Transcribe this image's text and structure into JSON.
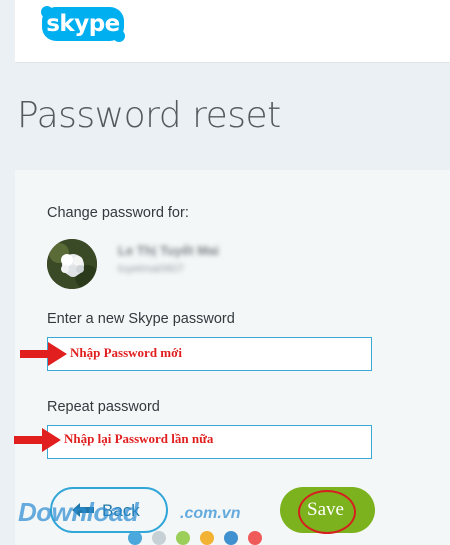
{
  "header": {
    "logo_text": "skype",
    "brand_color": "#00aff0"
  },
  "page": {
    "title": "Password reset"
  },
  "form": {
    "change_for_label": "Change password for:",
    "user": {
      "display_name": "Le Thị Tuyết Mai",
      "username": "tuyetmai0607",
      "blurred": true
    },
    "new_password": {
      "label": "Enter a new Skype password",
      "value": "",
      "annotation": "Nhập Password mới"
    },
    "repeat_password": {
      "label": "Repeat password",
      "value": "",
      "annotation": "Nhập lại Password lần nữa"
    },
    "back_label": "Back",
    "save_label": "Save"
  },
  "watermark": {
    "text": "Download",
    "suffix": ".com.vn",
    "dot_colors": [
      "#4aa8dc",
      "#c7d0d4",
      "#9bcf5a",
      "#f2b233",
      "#3f91d0",
      "#ef5a5a"
    ]
  },
  "colors": {
    "accent_blue": "#31a6d8",
    "save_green": "#7bb21d",
    "annotation_red": "#e11f1f"
  }
}
